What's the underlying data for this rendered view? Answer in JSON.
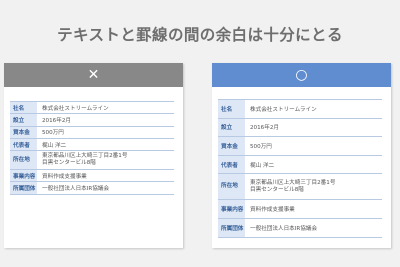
{
  "title": "テキストと罫線の間の余白は十分にとる",
  "bad": {
    "mark": "✕",
    "rows": [
      {
        "key": "社名",
        "value": [
          "株式会社ストリームライン"
        ]
      },
      {
        "key": "設立",
        "value": [
          "2016年2月"
        ]
      },
      {
        "key": "資本金",
        "value": [
          "500万円"
        ]
      },
      {
        "key": "代表者",
        "value": [
          "梶山 洋二"
        ]
      },
      {
        "key": "所在地",
        "value": [
          "東京都品川区上大崎三丁目2番1号",
          "目黒センタービル8階"
        ]
      },
      {
        "key": "事業内容",
        "value": [
          "資料作成支援事業"
        ]
      },
      {
        "key": "所属団体",
        "value": [
          "一般社団法人日本IR協議会"
        ]
      }
    ]
  },
  "good": {
    "mark": "○",
    "rows": [
      {
        "key": "社名",
        "value": [
          "株式会社ストリームライン"
        ]
      },
      {
        "key": "設立",
        "value": [
          "2016年2月"
        ]
      },
      {
        "key": "資本金",
        "value": [
          "500万円"
        ]
      },
      {
        "key": "代表者",
        "value": [
          "梶山 洋二"
        ]
      },
      {
        "key": "所在地",
        "value": [
          "東京都品川区上大崎三丁目2番1号",
          "目黒センタービル8階"
        ]
      },
      {
        "key": "事業内容",
        "value": [
          "資料作成支援事業"
        ]
      },
      {
        "key": "所属団体",
        "value": [
          "一般社団法人日本IR協議会"
        ]
      }
    ]
  }
}
